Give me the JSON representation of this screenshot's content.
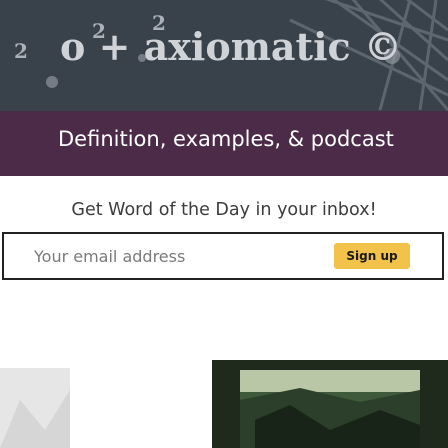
{
  "hero": {
    "title": "o + axiomatic ©",
    "caption": "Definition, examples, & podcast"
  },
  "newsletter": {
    "prompt": "Get Word of the Day in your inbox!",
    "email_placeholder": "Your email address",
    "signup_label": "Sign up"
  },
  "colors": {
    "hero_bg": "#3a4149",
    "caption_bg": "#4b2b47",
    "button": "#f2c24b"
  }
}
